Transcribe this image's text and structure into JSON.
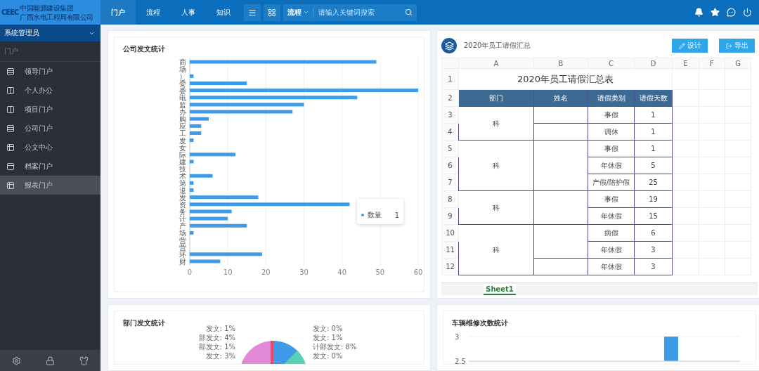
{
  "logo": {
    "mark": "CEEC",
    "line_1": "中国能源建设集团",
    "line_2": "广西水电工程局有限公司"
  },
  "top_nav": [
    {
      "label": "门户",
      "selected": true
    },
    {
      "label": "流程",
      "selected": false
    },
    {
      "label": "人事",
      "selected": false
    },
    {
      "label": "知识",
      "selected": false
    }
  ],
  "search": {
    "scope": "流程",
    "placeholder": "请输入关键词搜索"
  },
  "sidebar": {
    "user": "系统管理员",
    "section": "门户",
    "items": [
      {
        "label": "领导门户",
        "selected": false
      },
      {
        "label": "个人办公",
        "selected": false
      },
      {
        "label": "项目门户",
        "selected": false
      },
      {
        "label": "公司门户",
        "selected": false
      },
      {
        "label": "公文中心",
        "selected": false
      },
      {
        "label": "档案门户",
        "selected": false
      },
      {
        "label": "报表门户",
        "selected": true
      }
    ]
  },
  "company_chart": {
    "title": "公司发文统计",
    "tooltip": {
      "series": "数量",
      "value": "1"
    },
    "chart_data": {
      "type": "bar",
      "orientation": "horizontal",
      "grid": true,
      "categories": [
        "商",
        "场",
        "）",
        "委",
        "委",
        "电",
        "监",
        "办",
        "购",
        "应",
        "工",
        "发",
        "女",
        "际",
        "建",
        "技",
        "术",
        "第",
        "退",
        "发",
        "资",
        "务",
        "计",
        "产",
        "场",
        "营",
        "营",
        "环",
        "财"
      ],
      "values": [
        49,
        0,
        1,
        15,
        60,
        44,
        30,
        27,
        5,
        3,
        3,
        1,
        0,
        12,
        1,
        0,
        6,
        1,
        1,
        18,
        42,
        11,
        10,
        15,
        1,
        0,
        0,
        19,
        8
      ],
      "xlim": [
        0,
        60
      ],
      "xticks": [
        0,
        10,
        20,
        30,
        40,
        50,
        60
      ]
    }
  },
  "report": {
    "title": "2020年员工请假汇总",
    "buttons": [
      "设计",
      "导出"
    ],
    "columns": [
      "A",
      "B",
      "C",
      "D",
      "E",
      "F",
      "G"
    ],
    "row_numbers": [
      "1",
      "2",
      "3",
      "4",
      "5",
      "6",
      "7",
      "8",
      "9",
      "10",
      "11",
      "12"
    ],
    "sheet_title": "2020年员工请假汇总表",
    "headers": [
      "部门",
      "姓名",
      "请假类别",
      "请假天数"
    ],
    "groups": [
      {
        "department": "科",
        "people": [
          {
            "entries": [
              {
                "type": "事假",
                "days": "1"
              }
            ]
          },
          {
            "entries": [
              {
                "type": "调休",
                "days": "1"
              }
            ]
          }
        ]
      },
      {
        "department": "科",
        "people": [
          {
            "entries": [
              {
                "type": "事假",
                "days": "1"
              },
              {
                "type": "年休假",
                "days": "5"
              },
              {
                "type": "产假/陪护假",
                "days": "25"
              }
            ]
          }
        ]
      },
      {
        "department": "科",
        "people": [
          {
            "entries": [
              {
                "type": "事假",
                "days": "19"
              },
              {
                "type": "年休假",
                "days": "15"
              }
            ]
          }
        ]
      },
      {
        "department": "科",
        "people": [
          {
            "entries": [
              {
                "type": "病假",
                "days": "6"
              },
              {
                "type": "年休假",
                "days": "3"
              }
            ]
          },
          {
            "entries": [
              {
                "type": "年休假",
                "days": "3"
              }
            ]
          }
        ]
      }
    ],
    "sheets": [
      {
        "label": "Sheet1",
        "selected": true
      }
    ]
  },
  "dept_chart": {
    "title": "部门发文统计",
    "labels": [
      "发文: 1%",
      "发文: 0%",
      "部发文: 4%",
      "发文: 1%",
      "部发文: 1%",
      "计部发文: 8%",
      "发文: 3%",
      "发文: 0%"
    ]
  },
  "vehicle_chart": {
    "title": "车辆维修次数统计",
    "chart_data": {
      "type": "bar",
      "values": [
        null,
        null,
        null,
        null,
        3,
        null
      ],
      "ylim": [
        2.5,
        3
      ],
      "yticks": [
        2.5,
        3
      ]
    }
  }
}
